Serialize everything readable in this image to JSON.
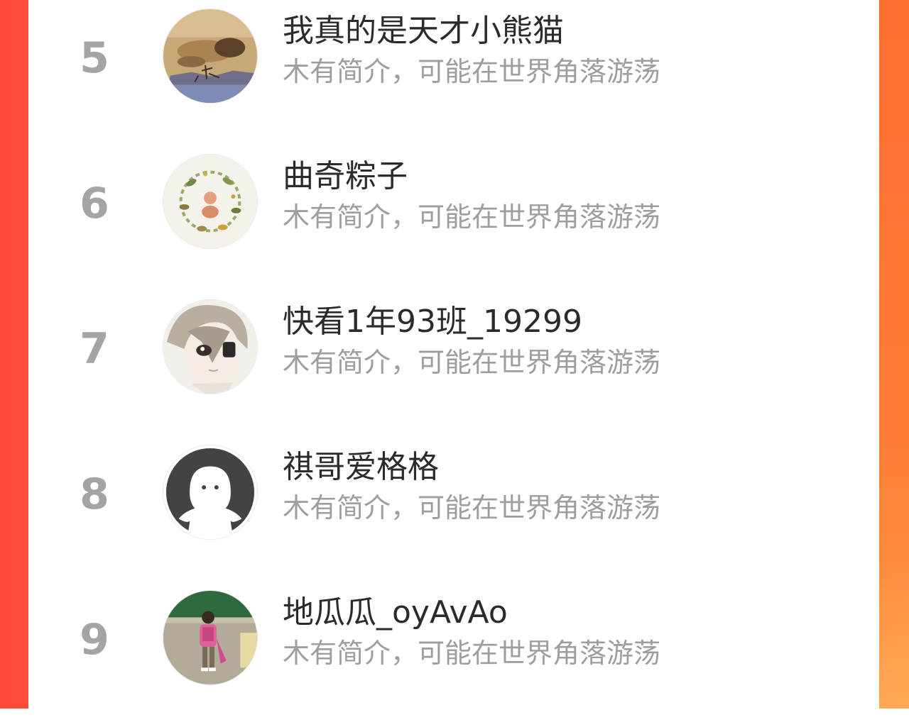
{
  "ranking": {
    "items": [
      {
        "rank": "5",
        "name": "我真的是天才小熊猫",
        "bio": "木有简介，可能在世界角落游荡",
        "avatar": "landscape-avatar"
      },
      {
        "rank": "6",
        "name": "曲奇粽子",
        "bio": "木有简介，可能在世界角落游荡",
        "avatar": "wreath-avatar"
      },
      {
        "rank": "7",
        "name": "快看1年93班_19299",
        "bio": "木有简介，可能在世界角落游荡",
        "avatar": "anime-boy-avatar"
      },
      {
        "rank": "8",
        "name": "祺哥爱格格",
        "bio": "木有简介，可能在世界角落游荡",
        "avatar": "default-ghost-avatar"
      },
      {
        "rank": "9",
        "name": "地瓜瓜_oyAvAo",
        "bio": "木有简介，可能在世界角落游荡",
        "avatar": "child-photo-avatar"
      }
    ]
  },
  "colors": {
    "background_left": "#ff4a3a",
    "background_right": "#ff7a36",
    "panel": "#ffffff",
    "rank_text": "#a4a4a4",
    "name_text": "#2b2b2b",
    "bio_text": "#9e9e9e"
  }
}
